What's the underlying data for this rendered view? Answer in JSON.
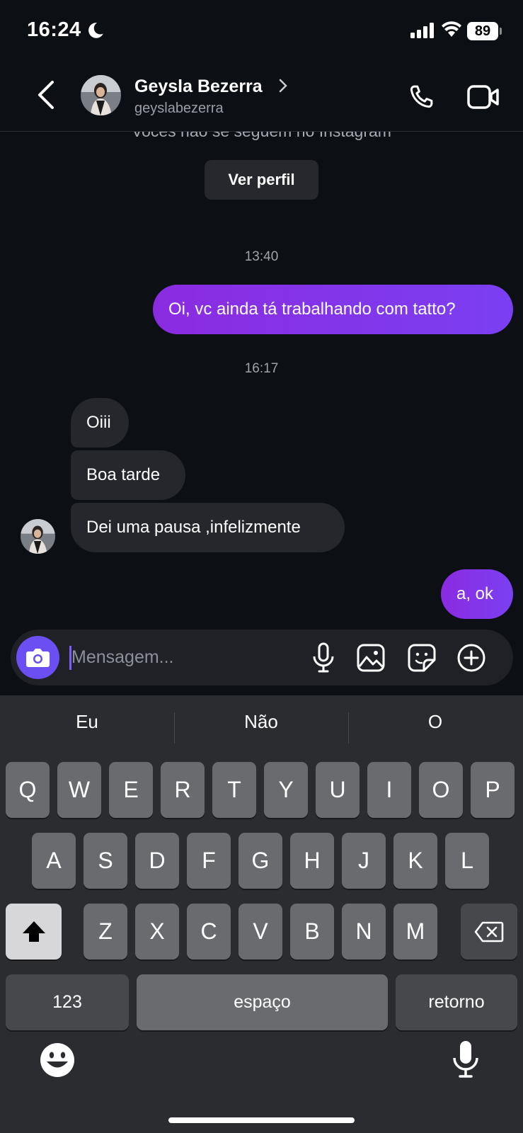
{
  "status_bar": {
    "time": "16:24",
    "battery": "89"
  },
  "header": {
    "name": "Geysla Bezerra",
    "username": "geyslabezerra"
  },
  "chat": {
    "follow_note": "Vocês não se seguem no Instagram",
    "view_profile": "Ver perfil",
    "timestamp_1": "13:40",
    "timestamp_2": "16:17",
    "messages": [
      {
        "text": "Oi, vc ainda tá trabalhando com tatto?",
        "sender": "me"
      },
      {
        "text": "Oiii",
        "sender": "them"
      },
      {
        "text": "Boa tarde",
        "sender": "them"
      },
      {
        "text": "Dei uma pausa ,infelizmente",
        "sender": "them"
      },
      {
        "text": "a, ok",
        "sender": "me"
      }
    ]
  },
  "composer": {
    "placeholder": "Mensagem..."
  },
  "keyboard": {
    "suggestions": [
      "Eu",
      "Não",
      "O"
    ],
    "row1": [
      "Q",
      "W",
      "E",
      "R",
      "T",
      "Y",
      "U",
      "I",
      "O",
      "P"
    ],
    "row2": [
      "A",
      "S",
      "D",
      "F",
      "G",
      "H",
      "J",
      "K",
      "L"
    ],
    "row3": [
      "Z",
      "X",
      "C",
      "V",
      "B",
      "N",
      "M"
    ],
    "numbers_label": "123",
    "space_label": "espaço",
    "return_label": "retorno"
  },
  "colors": {
    "accent": "#7b3ff2",
    "background": "#0c0f14",
    "received_bubble": "#25272c"
  }
}
